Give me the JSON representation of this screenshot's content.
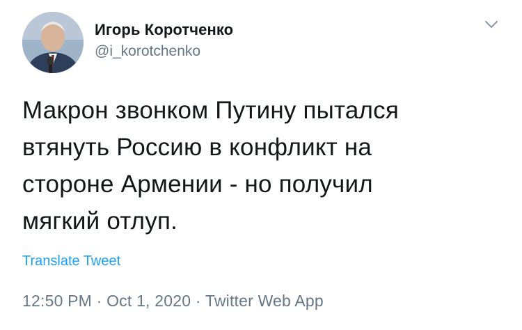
{
  "author": {
    "display_name": "Игорь Коротченко",
    "handle": "@i_korotchenko"
  },
  "icons": {
    "menu": "chevron-down-icon"
  },
  "tweet": {
    "lines": [
      "Макрон звонком Путину пытался",
      "втянуть Россию в конфликт на",
      "стороне Армении - но получил",
      "мягкий отлуп."
    ],
    "translate_label": "Translate Tweet"
  },
  "meta": {
    "time": "12:50 PM",
    "separator": "·",
    "date": "Oct 1, 2020",
    "source": "Twitter Web App"
  },
  "colors": {
    "link": "#1da1f2",
    "secondary_text": "#657786",
    "primary_text": "#14171a"
  }
}
